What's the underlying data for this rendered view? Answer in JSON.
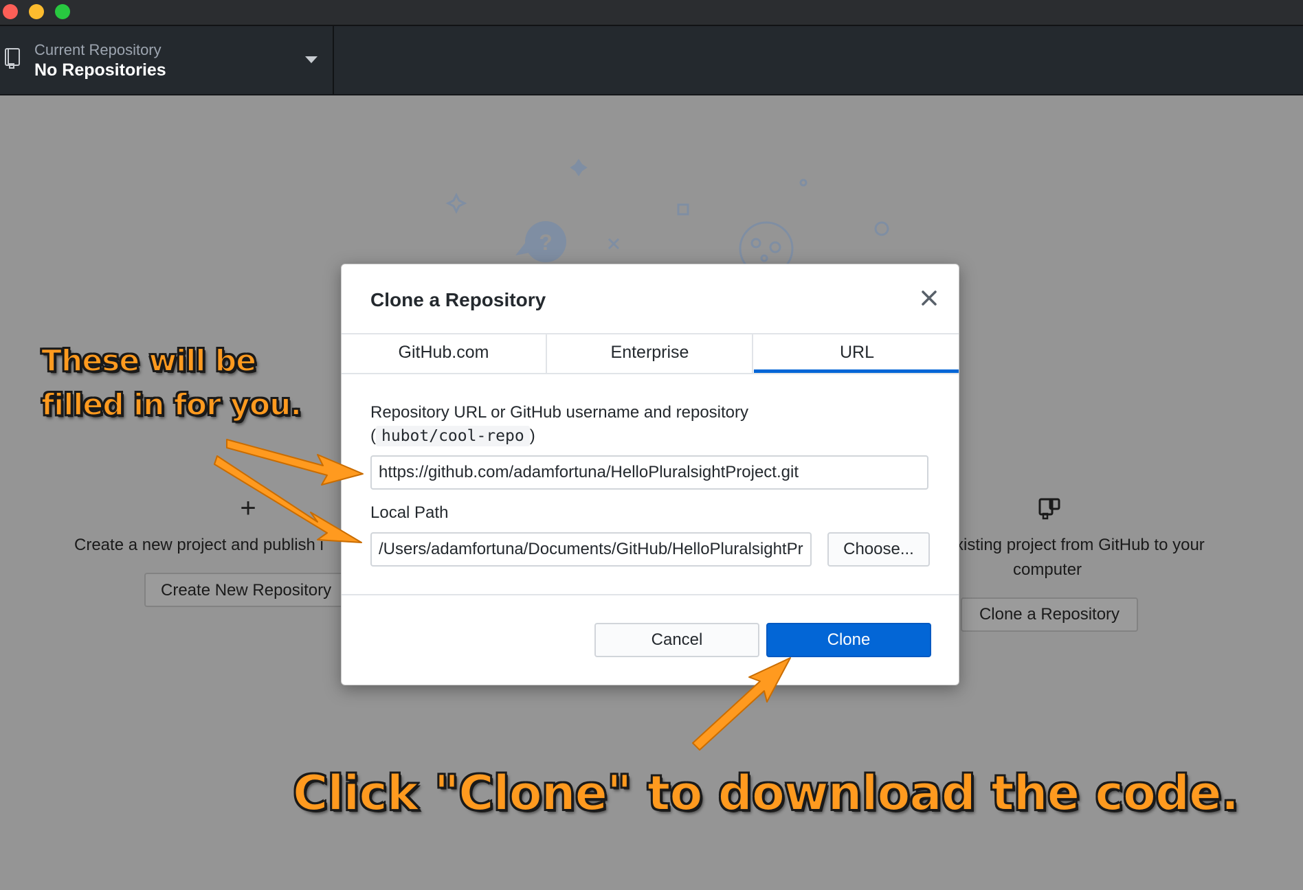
{
  "window": {
    "traffic_lights": [
      "close",
      "minimize",
      "zoom"
    ]
  },
  "toolbar": {
    "repo_label": "Current Repository",
    "repo_value": "No Repositories"
  },
  "blank_slate": {
    "create_text": "Create a new project and publish i",
    "create_button": "Create New Repository",
    "clone_text_line1": "xisting project from GitHub to your",
    "clone_text_line2": "computer",
    "clone_button": "Clone a Repository"
  },
  "dialog": {
    "title": "Clone a Repository",
    "tabs": [
      {
        "label": "GitHub.com",
        "selected": false
      },
      {
        "label": "Enterprise",
        "selected": false
      },
      {
        "label": "URL",
        "selected": true
      }
    ],
    "url_label": "Repository URL or GitHub username and repository",
    "hint_open": "(",
    "hint_code": "hubot/cool-repo",
    "hint_close": ")",
    "url_value": "https://github.com/adamfortuna/HelloPluralsightProject.git",
    "path_label": "Local Path",
    "path_value": "/Users/adamfortuna/Documents/GitHub/HelloPluralsightProject",
    "choose_button": "Choose...",
    "cancel_button": "Cancel",
    "clone_button": "Clone"
  },
  "annotations": {
    "line1": "These will be",
    "line2": "filled in for you.",
    "bottom": "Click \"Clone\" to download the code."
  },
  "colors": {
    "toolbar_bg": "#24292e",
    "backdrop": "#959595",
    "accent_blue": "#0366d6",
    "annotation_orange": "#ff9a1f"
  }
}
